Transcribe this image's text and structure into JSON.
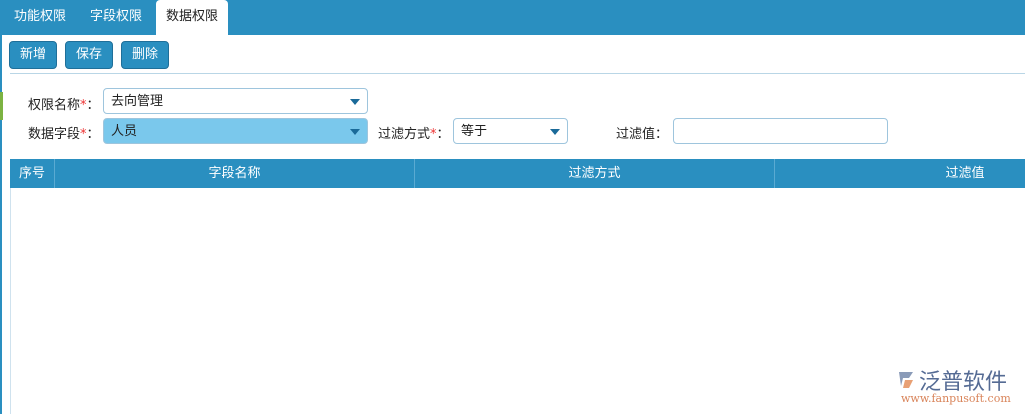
{
  "tabs": [
    {
      "label": "功能权限"
    },
    {
      "label": "字段权限"
    },
    {
      "label": "数据权限"
    }
  ],
  "toolbar": {
    "add": "新增",
    "save": "保存",
    "delete": "删除"
  },
  "form": {
    "perm_name_label": "权限名称",
    "perm_name_value": "去向管理",
    "field_label": "数据字段",
    "field_value": "人员",
    "filter_mode_label": "过滤方式",
    "filter_mode_value": "等于",
    "filter_value_label": "过滤值：",
    "filter_value": "",
    "required_mark": "*",
    "colon": "："
  },
  "grid": {
    "columns": [
      "序号",
      "字段名称",
      "过滤方式",
      "过滤值"
    ]
  },
  "watermark": {
    "brand": "泛普软件",
    "url": "www.fanpusoft.com"
  }
}
